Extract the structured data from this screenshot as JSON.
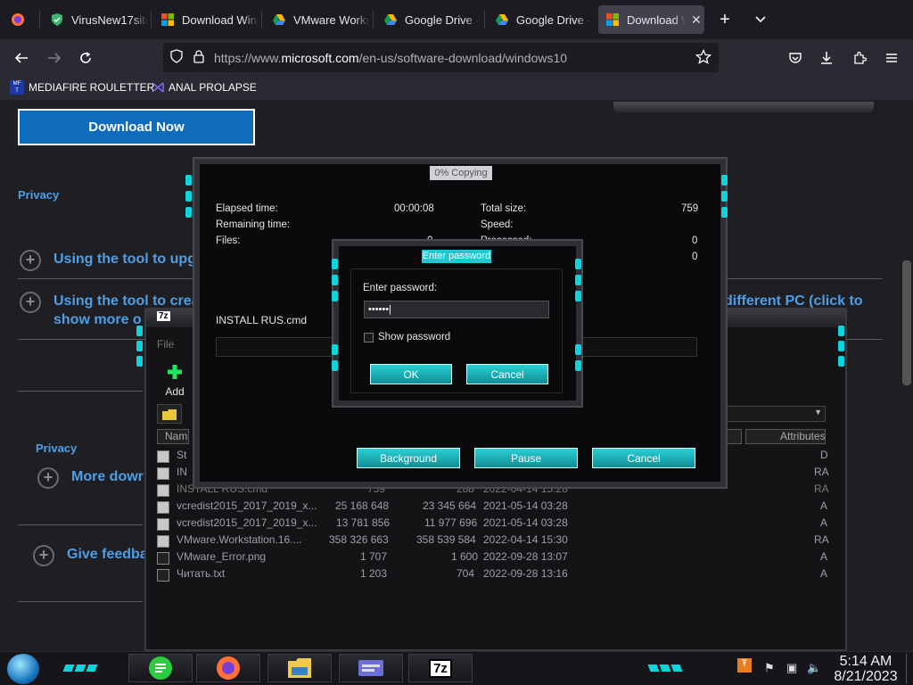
{
  "browser": {
    "tabs": [
      {
        "label": "",
        "icon": "firefox-icon"
      },
      {
        "label": "VirusNew17site",
        "icon": "shield-check-icon"
      },
      {
        "label": "Download Wind",
        "icon": "microsoft-logo-icon"
      },
      {
        "label": "VMware Workst",
        "icon": "google-drive-icon"
      },
      {
        "label": "Google Drive -",
        "icon": "google-drive-icon"
      },
      {
        "label": "Google Drive -",
        "icon": "google-drive-icon"
      },
      {
        "label": "Download W",
        "icon": "microsoft-logo-icon"
      }
    ],
    "url_prefix": "https://www.",
    "url_host": "microsoft.com",
    "url_path": "/en-us/software-download/windows10",
    "bookmarks": [
      {
        "label": "MEDIAFIRE ROULETTER",
        "icon": "mediafire-icon"
      },
      {
        "label": "ANAL PROLAPSE",
        "icon": "visual-studio-icon"
      }
    ]
  },
  "page": {
    "download_button": "Download Now",
    "privacy_1": "Privacy",
    "acc_1": "Using the tool to upg",
    "acc_2_line1": "Using the tool to crea",
    "acc_2_right": "different PC (click to",
    "acc_2_line2": "show more o",
    "privacy_2": "Privacy",
    "acc_3": "More dowr",
    "acc_4": "Give feedba"
  },
  "zip": {
    "title": "7z",
    "menu_file": "File",
    "add_label": "Add",
    "col_name": "Nam",
    "col_attributes": "Attributes",
    "rows": [
      {
        "name": "St",
        "size": "",
        "packed": "",
        "modified": "",
        "attr": "D"
      },
      {
        "name": "IN",
        "size": "",
        "packed": "",
        "modified": "",
        "attr": "RA"
      },
      {
        "name": "INSTALL RUS.cmd",
        "size": "759",
        "packed": "288",
        "modified": "2022-04-14 15:28",
        "attr": "RA"
      },
      {
        "name": "vcredist2015_2017_2019_x...",
        "size": "25 168 648",
        "packed": "23 345 664",
        "modified": "2021-05-14 03:28",
        "attr": "A"
      },
      {
        "name": "vcredist2015_2017_2019_x...",
        "size": "13 781 856",
        "packed": "11 977 696",
        "modified": "2021-05-14 03:28",
        "attr": "A"
      },
      {
        "name": "VMware.Workstation.16....",
        "size": "358 326 663",
        "packed": "358 539 584",
        "modified": "2022-04-14 15:30",
        "attr": "RA"
      },
      {
        "name": "VMware_Error.png",
        "size": "1 707",
        "packed": "1 600",
        "modified": "2022-09-28 13:07",
        "attr": "A"
      },
      {
        "name": "Читать.txt",
        "size": "1 203",
        "packed": "704",
        "modified": "2022-09-28 13:16",
        "attr": "A"
      }
    ]
  },
  "extract": {
    "title": "0% Copying",
    "elapsed_label": "Elapsed time:",
    "elapsed_value": "00:00:08",
    "remaining_label": "Remaining time:",
    "files_label": "Files:",
    "files_value": "0",
    "total_size_label": "Total size:",
    "total_size_value": "759",
    "speed_label": "Speed:",
    "processed_label": "Processed:",
    "processed_value": "0",
    "extra_value": "0",
    "current_file": "INSTALL RUS.cmd",
    "btn_background": "Background",
    "btn_pause": "Pause",
    "btn_cancel": "Cancel"
  },
  "password": {
    "title": "Enter password",
    "label": "Enter password:",
    "value": "••••••",
    "show_password": "Show password",
    "ok": "OK",
    "cancel": "Cancel"
  },
  "taskbar": {
    "time": "5:14 AM",
    "date": "8/21/2023"
  },
  "colors": {
    "accent_cyan": "#11d3dc",
    "link_blue": "#4e9ee6",
    "download_blue": "#0f6cbd"
  }
}
